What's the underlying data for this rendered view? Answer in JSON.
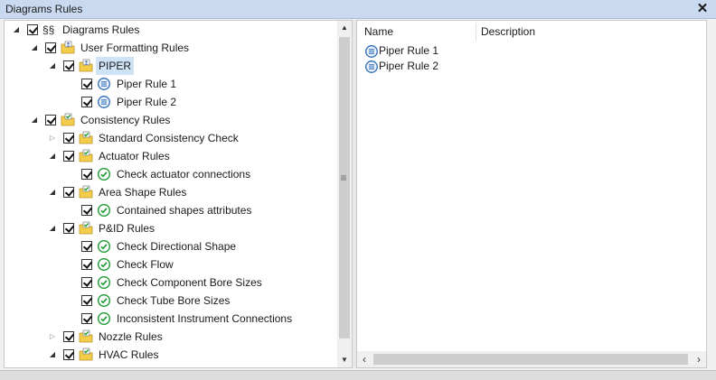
{
  "window": {
    "title": "Diagrams Rules"
  },
  "tree": {
    "root_symbol": "§§",
    "items": [
      {
        "label": "Diagrams Rules",
        "icon": "section-icon",
        "depth": 0,
        "expander": "expanded"
      },
      {
        "label": "User Formatting Rules",
        "icon": "folder-user-icon",
        "depth": 1,
        "expander": "expanded"
      },
      {
        "label": "PIPER",
        "icon": "folder-user-icon",
        "depth": 2,
        "expander": "expanded",
        "selected": true
      },
      {
        "label": "Piper Rule 1",
        "icon": "list-rule-icon",
        "depth": 3,
        "expander": "none"
      },
      {
        "label": "Piper Rule 2",
        "icon": "list-rule-icon",
        "depth": 3,
        "expander": "none"
      },
      {
        "label": "Consistency Rules",
        "icon": "folder-check-icon",
        "depth": 1,
        "expander": "expanded"
      },
      {
        "label": "Standard Consistency Check",
        "icon": "folder-check-icon",
        "depth": 2,
        "expander": "collapsed"
      },
      {
        "label": "Actuator Rules",
        "icon": "folder-check-icon",
        "depth": 2,
        "expander": "expanded"
      },
      {
        "label": "Check actuator connections",
        "icon": "check-circle-icon",
        "depth": 3,
        "expander": "none"
      },
      {
        "label": "Area Shape Rules",
        "icon": "folder-check-icon",
        "depth": 2,
        "expander": "expanded"
      },
      {
        "label": "Contained shapes attributes",
        "icon": "check-circle-icon",
        "depth": 3,
        "expander": "none"
      },
      {
        "label": "P&ID Rules",
        "icon": "folder-check-icon",
        "depth": 2,
        "expander": "expanded"
      },
      {
        "label": "Check Directional Shape",
        "icon": "check-circle-icon",
        "depth": 3,
        "expander": "none"
      },
      {
        "label": "Check Flow",
        "icon": "check-circle-icon",
        "depth": 3,
        "expander": "none"
      },
      {
        "label": "Check Component Bore Sizes",
        "icon": "check-circle-icon",
        "depth": 3,
        "expander": "none"
      },
      {
        "label": "Check Tube Bore Sizes",
        "icon": "check-circle-icon",
        "depth": 3,
        "expander": "none"
      },
      {
        "label": "Inconsistent Instrument Connections",
        "icon": "check-circle-icon",
        "depth": 3,
        "expander": "none"
      },
      {
        "label": "Nozzle Rules",
        "icon": "folder-check-icon",
        "depth": 2,
        "expander": "collapsed"
      },
      {
        "label": "HVAC Rules",
        "icon": "folder-check-icon",
        "depth": 2,
        "expander": "expanded"
      }
    ]
  },
  "detail": {
    "columns": [
      "Name",
      "Description"
    ],
    "rows": [
      {
        "name": "Piper Rule 1",
        "description": ""
      },
      {
        "name": "Piper Rule 2",
        "description": ""
      }
    ]
  },
  "colors": {
    "titlebar": "#c9daf0",
    "selection": "#cfe3f6",
    "check_green": "#1e9b32",
    "folder_yellow": "#f4cd4a",
    "rule_blue": "#2f6db5"
  }
}
